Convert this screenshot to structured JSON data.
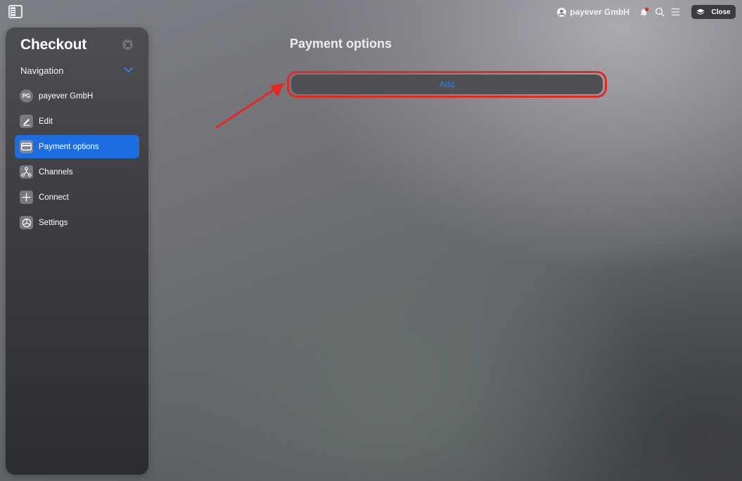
{
  "topbar": {
    "account_name": "payever GmbH",
    "close_label": "Close"
  },
  "sidebar": {
    "title": "Checkout",
    "nav_header": "Navigation",
    "items": [
      {
        "label": "payever GmbH",
        "icon": "avatar-initials",
        "initials": "PG",
        "active": false
      },
      {
        "label": "Edit",
        "icon": "pencil-icon",
        "active": false
      },
      {
        "label": "Payment options",
        "icon": "credit-card-icon",
        "active": true
      },
      {
        "label": "Channels",
        "icon": "channels-icon",
        "active": false
      },
      {
        "label": "Connect",
        "icon": "plus-icon",
        "active": false
      },
      {
        "label": "Settings",
        "icon": "settings-icon",
        "active": false
      }
    ]
  },
  "main": {
    "title": "Payment options",
    "add_label": "Add"
  },
  "colors": {
    "active_item": "#1c6de0",
    "add_text": "#2f7fdc",
    "highlight_border": "#e02a23",
    "notification_dot": "#e02a23"
  }
}
